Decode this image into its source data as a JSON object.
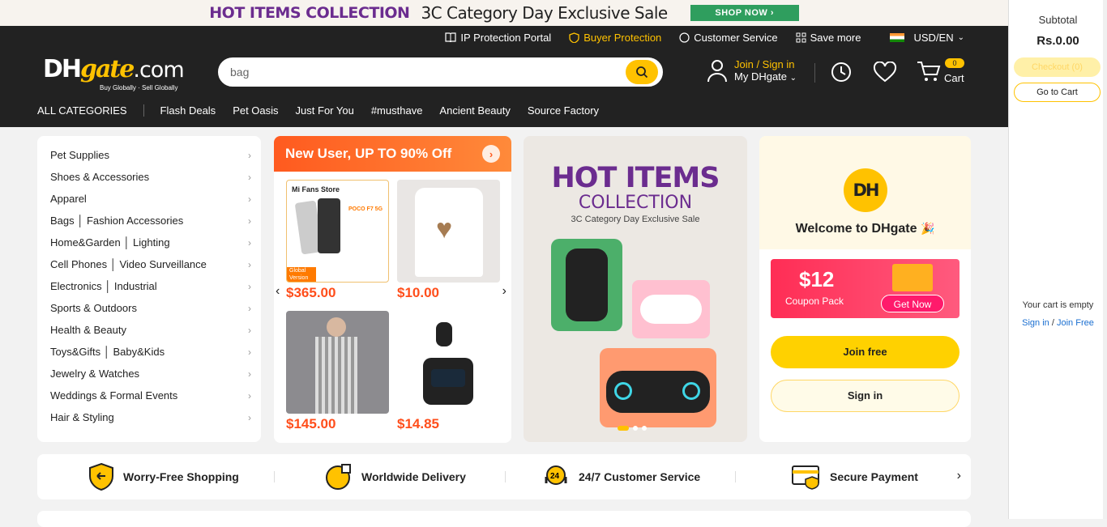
{
  "top_banner": {
    "title": "HOT ITEMS COLLECTION",
    "subtitle": "3C Category Day Exclusive Sale",
    "button": "SHOP NOW"
  },
  "top_nav": {
    "ip_protection": "IP Protection Portal",
    "buyer_protection": "Buyer Protection",
    "customer_service": "Customer Service",
    "save_more": "Save more",
    "currency": "USD/EN"
  },
  "logo": {
    "text_a": "DH",
    "text_b": "gate",
    "text_c": ".com",
    "tagline": "Buy Globally · Sell Globally"
  },
  "search": {
    "value": "bag"
  },
  "account": {
    "join": "Join / Sign in",
    "my": "My DHgate"
  },
  "cart": {
    "label": "Cart",
    "count": "0"
  },
  "category_nav": {
    "all": "ALL CATEGORIES",
    "links": [
      "Flash Deals",
      "Pet Oasis",
      "Just For You",
      "#musthave",
      "Ancient Beauty",
      "Source Factory"
    ]
  },
  "categories": [
    "Pet Supplies",
    "Shoes & Accessories",
    "Apparel",
    "Bags │ Fashion Accessories",
    "Home&Garden │ Lighting",
    "Cell Phones │ Video Surveillance",
    "Electronics │ Industrial",
    "Sports & Outdoors",
    "Health & Beauty",
    "Toys&Gifts │ Baby&Kids",
    "Jewelry & Watches",
    "Weddings & Formal Events",
    "Hair & Styling"
  ],
  "new_user": {
    "title": "New User,  UP TO 90% Off",
    "products": [
      {
        "price": "$365.00",
        "store": "Mi Fans Store",
        "model": "POCO F7 5G",
        "tag": "Global Version"
      },
      {
        "price": "$10.00"
      },
      {
        "price": "$145.00"
      },
      {
        "price": "$14.85"
      }
    ]
  },
  "hot_items": {
    "title": "HOT ITEMS",
    "title2": "COLLECTION",
    "sub": "3C Category Day Exclusive Sale"
  },
  "welcome": {
    "logo": "DH",
    "title": "Welcome to DHgate",
    "coupon_amount": "$12",
    "coupon_label": "Coupon Pack",
    "coupon_button": "Get Now",
    "join": "Join free",
    "signin": "Sign in"
  },
  "benefits": [
    "Worry-Free Shopping",
    "Worldwide Delivery",
    "24/7 Customer Service",
    "Secure Payment"
  ],
  "side_cart": {
    "subtotal_label": "Subtotal",
    "subtotal": "Rs.0.00",
    "checkout": "Checkout (0)",
    "go_to_cart": "Go to Cart",
    "empty": "Your cart is empty",
    "sign_in": "Sign in",
    "join_free": "Join Free"
  },
  "colors": {
    "brand_yellow": "#ffc200",
    "header_bg": "#222222",
    "accent_orange": "#ff4e1b",
    "purple": "#6b2c8f"
  }
}
